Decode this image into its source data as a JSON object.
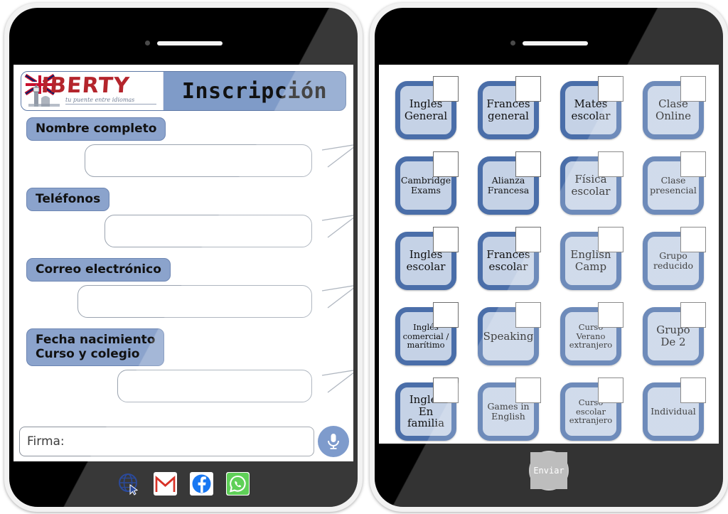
{
  "left_phone": {
    "header": {
      "logo_word": "IBERTY",
      "logo_tagline": "tu puente entre idiomas",
      "logo_icon": "uk-flag-bigben-logo",
      "title": "Inscripción"
    },
    "fields": [
      {
        "label": "Nombre completo",
        "value": "",
        "name": "nombre-completo"
      },
      {
        "label": "Teléfonos",
        "value": "",
        "name": "telefonos"
      },
      {
        "label": "Correo electrónico",
        "value": "",
        "name": "correo-electronico"
      },
      {
        "label": "Fecha nacimiento\nCurso y colegio",
        "value": "",
        "name": "fecha-curso-colegio"
      }
    ],
    "signature": {
      "label": "Firma:",
      "value": "",
      "mic_icon": "microphone-icon"
    },
    "app_bar": [
      {
        "name": "globe-icon",
        "label": "Web"
      },
      {
        "name": "gmail-icon",
        "label": "Gmail"
      },
      {
        "name": "facebook-icon",
        "label": "Facebook"
      },
      {
        "name": "whatsapp-icon",
        "label": "WhatsApp"
      }
    ]
  },
  "right_phone": {
    "courses": [
      {
        "label": "Inglés\nGeneral",
        "checked": false,
        "size": "normal"
      },
      {
        "label": "Francés\ngeneral",
        "checked": false,
        "size": "normal"
      },
      {
        "label": "Mates\nescolar",
        "checked": false,
        "size": "normal"
      },
      {
        "label": "Clase\nOnline",
        "checked": false,
        "size": "normal"
      },
      {
        "label": "Cambridge\nExams",
        "checked": false,
        "size": "small"
      },
      {
        "label": "Alianza\nFrancesa",
        "checked": false,
        "size": "small"
      },
      {
        "label": "Física\nescolar",
        "checked": false,
        "size": "normal"
      },
      {
        "label": "Clase\npresencial",
        "checked": false,
        "size": "small"
      },
      {
        "label": "Inglés\nescolar",
        "checked": false,
        "size": "normal"
      },
      {
        "label": "Francés\nescolar",
        "checked": false,
        "size": "normal"
      },
      {
        "label": "English\nCamp",
        "checked": false,
        "size": "normal"
      },
      {
        "label": "Grupo\nreducido",
        "checked": false,
        "size": "small"
      },
      {
        "label": "Inglés\ncomercial /\nmarítimo",
        "checked": false,
        "size": "tiny"
      },
      {
        "label": "Speaking",
        "checked": false,
        "size": "normal"
      },
      {
        "label": "Curso\nVerano\nextranjero",
        "checked": false,
        "size": "tiny"
      },
      {
        "label": "Grupo\nDe 2",
        "checked": false,
        "size": "normal"
      },
      {
        "label": "Inglés\nEn\nfamilia",
        "checked": false,
        "size": "normal"
      },
      {
        "label": "Games in\nEnglish",
        "checked": false,
        "size": "small"
      },
      {
        "label": "Curso\nescolar\nextranjero",
        "checked": false,
        "size": "tiny"
      },
      {
        "label": "Individual",
        "checked": false,
        "size": "small"
      }
    ],
    "send_button": {
      "label": "Enviar",
      "name": "enviar-button"
    }
  },
  "colors": {
    "header_blue": "#7f9bc8",
    "pill_blue": "#8ba3cc",
    "tile_fill": "#c5d2e6",
    "tile_border": "#4a6ea9",
    "logo_red": "#b4252c",
    "mic_blue": "#5a7fbe"
  }
}
